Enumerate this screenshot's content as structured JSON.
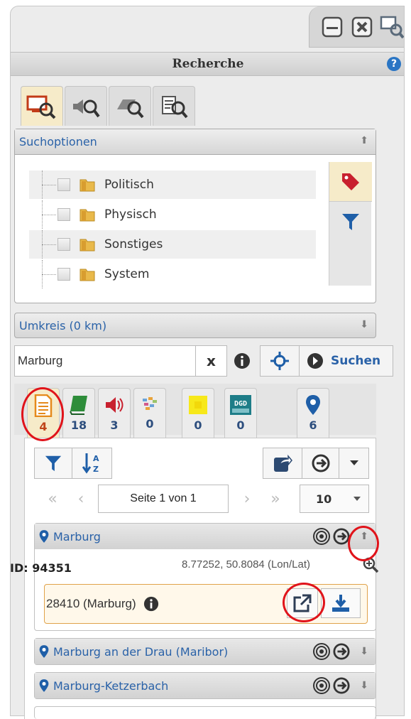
{
  "window": {
    "controls": [
      "minimize-icon",
      "close-icon",
      "search-window-icon"
    ]
  },
  "header": {
    "title": "Recherche",
    "help": "?"
  },
  "tool_tabs": [
    {
      "icon": "map-search-icon",
      "active": true
    },
    {
      "icon": "audio-search-icon",
      "active": false
    },
    {
      "icon": "map-stack-search-icon",
      "active": false
    },
    {
      "icon": "document-search-icon",
      "active": false
    }
  ],
  "search_options": {
    "title": "Suchoptionen",
    "items": [
      {
        "label": "Politisch"
      },
      {
        "label": "Physisch"
      },
      {
        "label": "Sonstiges"
      },
      {
        "label": "System"
      }
    ],
    "side_tools": [
      "tag-icon",
      "filter-icon"
    ]
  },
  "radius": {
    "label": "Umkreis (0 km)"
  },
  "search": {
    "value": "Marburg",
    "clear": "x",
    "button_label": "Suchen"
  },
  "result_tabs": [
    {
      "icon": "document-icon",
      "count": "4",
      "active": true
    },
    {
      "icon": "book-icon",
      "count": "18",
      "active": false
    },
    {
      "icon": "speaker-icon",
      "count": "3",
      "active": false
    },
    {
      "icon": "image-tiles-icon",
      "count": "0",
      "active": false
    },
    {
      "icon": "yellow-square-icon",
      "count": "0",
      "active": false
    },
    {
      "icon": "dgd-icon",
      "count": "0",
      "active": false,
      "badge": "DGD"
    },
    {
      "icon": "location-pin-icon",
      "count": "6",
      "active": false
    }
  ],
  "pager": {
    "label": "Seite 1 von 1",
    "page_size": "10",
    "first": "«",
    "prev": "‹",
    "next": "›",
    "last": "»"
  },
  "results": [
    {
      "title": "Marburg",
      "id": "ID: 94351",
      "coords": "8.77252, 50.8084 (Lon/Lat)",
      "sub_item": "28410 (Marburg)",
      "expanded": true
    },
    {
      "title": "Marburg an der Drau (Maribor)",
      "expanded": false
    },
    {
      "title": "Marburg-Ketzerbach",
      "expanded": false
    }
  ],
  "colors": {
    "accent_blue": "#2a62a8",
    "active_tab": "#f6ebc9",
    "highlight_red": "#e0131a",
    "sub_item_border": "#e0a24a"
  }
}
